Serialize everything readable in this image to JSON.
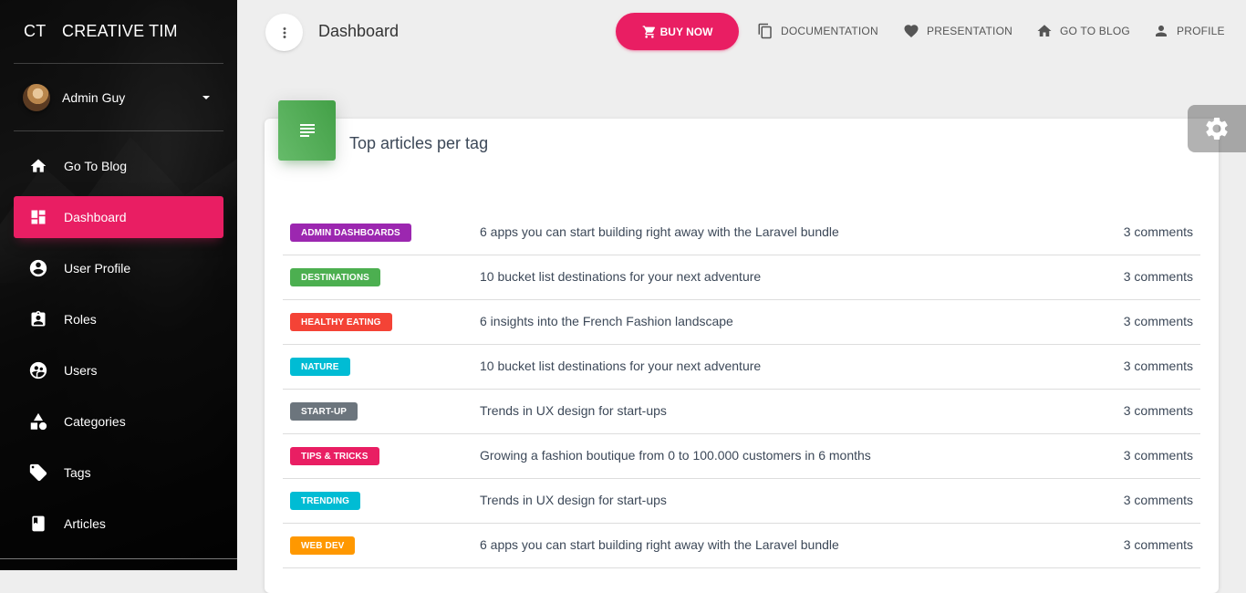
{
  "sidebar": {
    "brand_mini": "CT",
    "brand_full": "CREATIVE TIM",
    "user_name": "Admin Guy",
    "items": [
      {
        "label": "Go To Blog",
        "icon": "home-icon"
      },
      {
        "label": "Dashboard",
        "icon": "dashboard-icon",
        "active": true
      },
      {
        "label": "User Profile",
        "icon": "account-circle-icon"
      },
      {
        "label": "Roles",
        "icon": "assignment-ind-icon"
      },
      {
        "label": "Users",
        "icon": "supervised-user-icon"
      },
      {
        "label": "Categories",
        "icon": "category-icon"
      },
      {
        "label": "Tags",
        "icon": "tag-icon"
      },
      {
        "label": "Articles",
        "icon": "book-icon"
      }
    ],
    "active_color": "#e91e63"
  },
  "topbar": {
    "page_title": "Dashboard",
    "buy_now": "BUY NOW",
    "documentation": "DOCUMENTATION",
    "presentation": "PRESENTATION",
    "go_to_blog": "GO TO BLOG",
    "profile": "PROFILE"
  },
  "card": {
    "title": "Top articles per tag",
    "icon": "list-icon",
    "rows": [
      {
        "tag": "ADMIN DASHBOARDS",
        "tag_color": "#9c27b0",
        "article": "6 apps you can start building right away with the Laravel bundle",
        "comments": "3 comments"
      },
      {
        "tag": "DESTINATIONS",
        "tag_color": "#4caf50",
        "article": "10 bucket list destinations for your next adventure",
        "comments": "3 comments"
      },
      {
        "tag": "HEALTHY EATING",
        "tag_color": "#f44336",
        "article": "6 insights into the French Fashion landscape",
        "comments": "3 comments"
      },
      {
        "tag": "NATURE",
        "tag_color": "#00bcd4",
        "article": "10 bucket list destinations for your next adventure",
        "comments": "3 comments"
      },
      {
        "tag": "START-UP",
        "tag_color": "#6c757d",
        "article": "Trends in UX design for start-ups",
        "comments": "3 comments"
      },
      {
        "tag": "TIPS & TRICKS",
        "tag_color": "#e91e63",
        "article": "Growing a fashion boutique from 0 to 100.000 customers in 6 months",
        "comments": "3 comments"
      },
      {
        "tag": "TRENDING",
        "tag_color": "#00bcd4",
        "article": "Trends in UX design for start-ups",
        "comments": "3 comments"
      },
      {
        "tag": "WEB DEV",
        "tag_color": "#ff9800",
        "article": "6 apps you can start building right away with the Laravel bundle",
        "comments": "3 comments"
      }
    ]
  }
}
